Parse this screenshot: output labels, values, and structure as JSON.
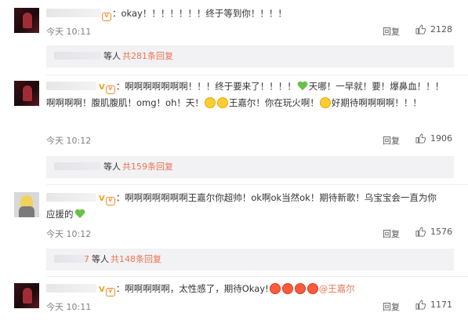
{
  "comments": [
    {
      "text": "：okay！！！！！！！终于等到你！！！！",
      "time": "今天 10:11",
      "reply": "回复",
      "likes": "2128"
    },
    {
      "text_a": "：啊啊啊啊啊啊啊！！！终于要来了！！！！",
      "text_b": "天哪！一早就！要！爆鼻血！！！啊啊啊啊！腹肌腹肌！omg！oh！天！",
      "text_c": "王嘉尔！你在玩火啊！",
      "text_d": "好期待啊啊啊啊！！！",
      "time": "今天 10:12",
      "reply": "回复",
      "likes": "1906"
    },
    {
      "text_a": "：啊啊啊啊啊啊啊王嘉尔你超帅！ok啊ok当然ok！期待新歌！乌宝宝会一直为你应援的",
      "time": "今天 10:12",
      "reply": "回复",
      "likes": "1576"
    },
    {
      "text_a": "：啊啊啊啊啊，太性感了，期待Okay!",
      "mention": "@王嘉尔",
      "time": "今天 10:11",
      "reply": "回复",
      "likes": "1171"
    }
  ],
  "reply_threads": [
    {
      "label": "等人",
      "count": "共281条回复"
    },
    {
      "label": "等人",
      "count": "共159条回复"
    },
    {
      "prefix": "7",
      "label": "等人",
      "count": "共148条回复"
    }
  ],
  "colors": {
    "accent": "#eb7350",
    "vip": "#f28a2a",
    "heart": "#6cc04a"
  }
}
